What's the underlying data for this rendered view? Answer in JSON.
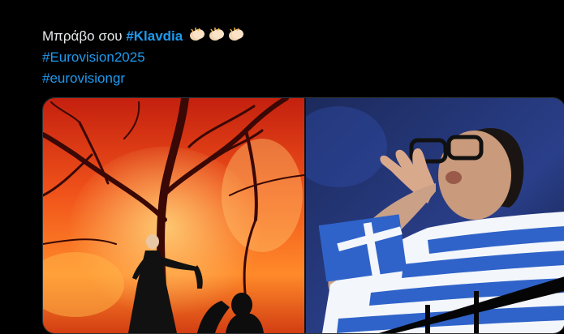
{
  "tweet": {
    "body_prefix": "Μπράβο σου ",
    "mention": "#Klavdia",
    "hashtags": [
      "#Eurovision2025",
      "#eurovisiongr"
    ]
  },
  "media": {
    "photos": [
      {
        "name": "performer-on-stage"
      },
      {
        "name": "fan-with-greek-flag"
      }
    ]
  },
  "icons": [
    "clapping-hands-icon",
    "clapping-hands-icon",
    "clapping-hands-icon"
  ],
  "colors": {
    "link": "#1d9bf0",
    "background": "#000000",
    "text": "#e7e9ea",
    "border": "#2f3336"
  }
}
